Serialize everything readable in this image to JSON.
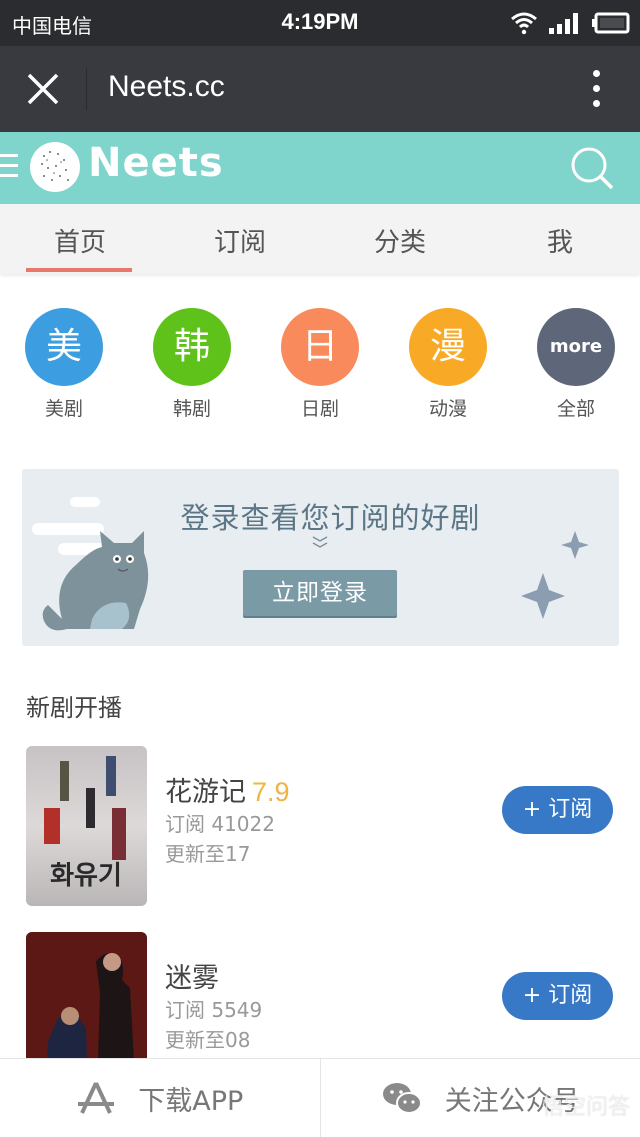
{
  "status_bar": {
    "carrier": "中国电信",
    "time": "4:19PM",
    "icons": [
      "wifi-icon",
      "signal-icon",
      "battery-icon"
    ]
  },
  "browser": {
    "title": "Neets.cc",
    "close_icon": "close-icon",
    "menu_icon": "more-vertical-icon"
  },
  "app_header": {
    "brand": "Neets",
    "menu_icon": "hamburger-icon",
    "search_icon": "search-icon",
    "color": "#7fd4cb"
  },
  "tabs": [
    {
      "label": "首页",
      "active": true
    },
    {
      "label": "订阅",
      "active": false
    },
    {
      "label": "分类",
      "active": false
    },
    {
      "label": "我",
      "active": false
    }
  ],
  "categories": [
    {
      "glyph": "美",
      "label": "美剧",
      "color": "#3c9ee0"
    },
    {
      "glyph": "韩",
      "label": "韩剧",
      "color": "#5ec21a"
    },
    {
      "glyph": "日",
      "label": "日剧",
      "color": "#f98a5c"
    },
    {
      "glyph": "漫",
      "label": "动漫",
      "color": "#f8a925"
    },
    {
      "glyph": "more",
      "label": "全部",
      "color": "#5d6779"
    }
  ],
  "banner": {
    "headline": "登录查看您订阅的好剧",
    "button": "立即登录"
  },
  "section": {
    "title": "新剧开播"
  },
  "shows": [
    {
      "name": "花游记",
      "score": "7.9",
      "subscribers": "订阅 41022",
      "update": "更新至17",
      "button": "+ 订阅"
    },
    {
      "name": "迷雾",
      "score": "",
      "subscribers": "订阅 5549",
      "update": "更新至08",
      "button": "+ 订阅"
    }
  ],
  "bottom_bar": {
    "download": "下载APP",
    "follow": "关注公众号"
  },
  "watermark": "悟空问答"
}
